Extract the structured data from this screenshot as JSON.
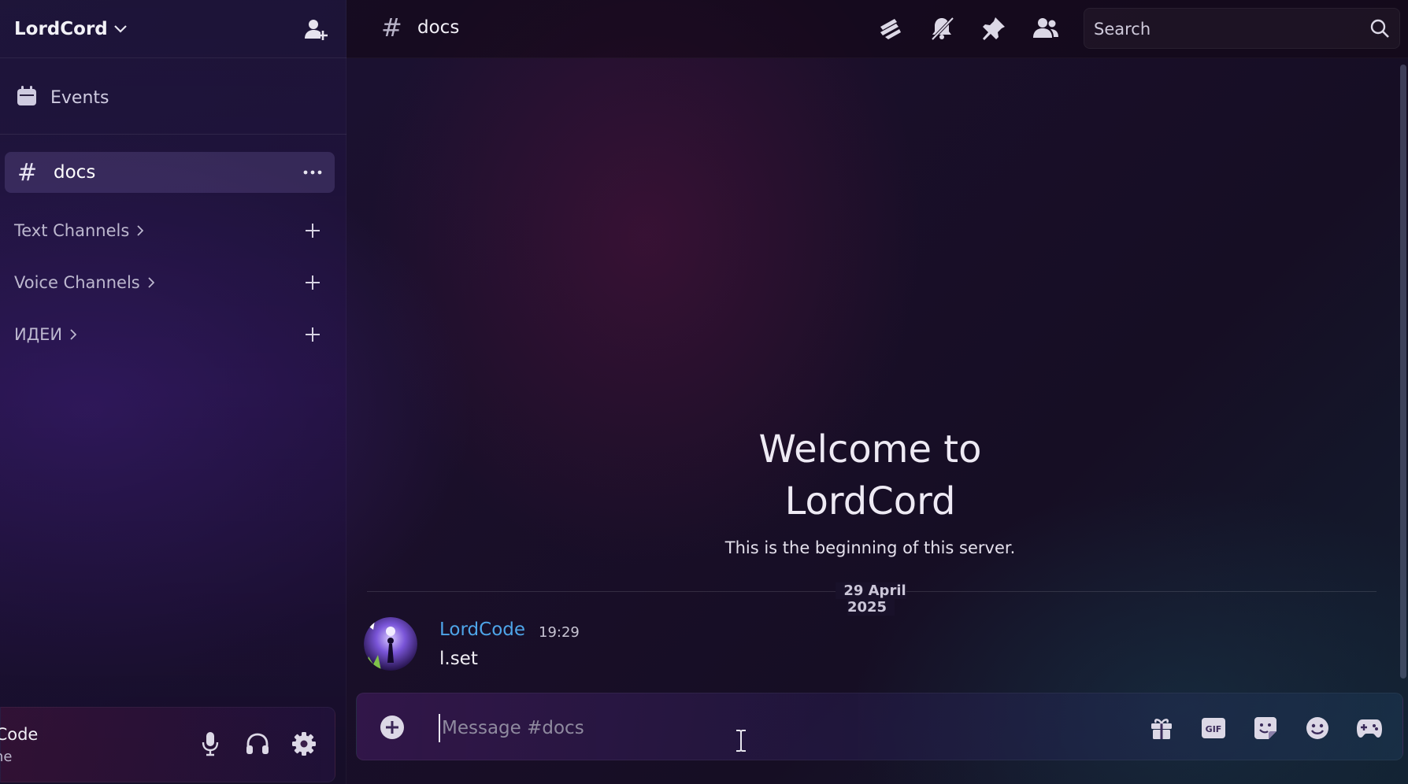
{
  "server": {
    "name": "LordCord",
    "invite_icon": "add-user-icon"
  },
  "sidebar": {
    "events_label": "Events",
    "active_channel": {
      "hash": "#",
      "name": "docs"
    },
    "categories": [
      {
        "label": "Text Channels"
      },
      {
        "label": "Voice Channels"
      },
      {
        "label": "ИДЕИ"
      }
    ]
  },
  "user_panel": {
    "name": "rdCode",
    "status": "line"
  },
  "topbar": {
    "hash": "#",
    "channel": "docs",
    "icons": [
      "threads-icon",
      "mute-notifications-icon",
      "pin-icon",
      "members-icon"
    ],
    "search_placeholder": "Search"
  },
  "welcome": {
    "title": "Welcome to LordCord",
    "subtitle": "This is the beginning of this server."
  },
  "date_divider": "29 April 2025",
  "message": {
    "author": "LordCode",
    "time": "19:29",
    "text": "l.set"
  },
  "composer": {
    "placeholder": "Message #docs",
    "icons": [
      "gift-icon",
      "gif-icon",
      "sticker-icon",
      "emoji-icon",
      "game-icon"
    ],
    "gif_label": "GIF"
  },
  "colors": {
    "author": "#4ea5e9",
    "active_channel_bg": "#5a4a80"
  }
}
